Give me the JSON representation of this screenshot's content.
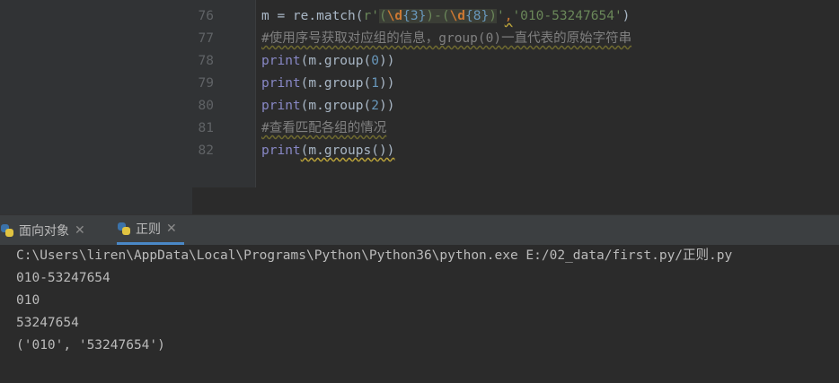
{
  "editor": {
    "lines": [
      {
        "num": "76"
      },
      {
        "num": "77",
        "comment": "#使用序号获取对应组的信息，group(0)一直代表的原始字符串"
      },
      {
        "num": "78"
      },
      {
        "num": "79"
      },
      {
        "num": "80"
      },
      {
        "num": "81",
        "comment": "#查看匹配各组的情况"
      },
      {
        "num": "82"
      }
    ],
    "l76": {
      "prefix": "m = re.match(",
      "r": "r'",
      "p1": "(",
      "e1": "\\d",
      "q1": "{3}",
      "p2": ")-(",
      "e2": "\\d",
      "q2": "{8}",
      "p3": ")",
      "q": "'",
      "comma": ",",
      "arg": "'010-53247654'",
      "close": ")"
    },
    "l78": {
      "fn": "print",
      "rest_a": "(m.group(",
      "n": "0",
      "rest_b": "))"
    },
    "l79": {
      "fn": "print",
      "rest_a": "(m.group(",
      "n": "1",
      "rest_b": "))"
    },
    "l80": {
      "fn": "print",
      "rest_a": "(m.group(",
      "n": "2",
      "rest_b": "))"
    },
    "l82": {
      "fn": "print",
      "rest": "(m.groups())"
    }
  },
  "tabs": [
    {
      "label": "面向对象",
      "close": "✕"
    },
    {
      "label": "正则",
      "close": "✕"
    }
  ],
  "console": {
    "lines": [
      "C:\\Users\\liren\\AppData\\Local\\Programs\\Python\\Python36\\python.exe E:/02_data/first.py/正则.py",
      "010-53247654",
      "010",
      "53247654",
      "('010', '53247654')"
    ]
  },
  "colors": {
    "accent": "#4a88c7",
    "background": "#2b2b2b",
    "gutter": "#313335"
  }
}
